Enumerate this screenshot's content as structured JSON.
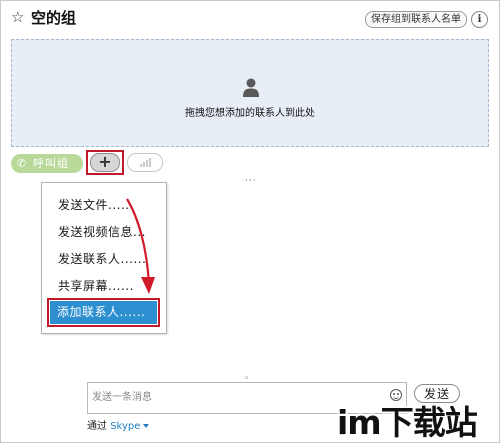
{
  "header": {
    "title": "空的组",
    "save_label": "保存组到联系人名单",
    "info_label": "i"
  },
  "dropzone": {
    "text": "拖拽您想添加的联系人到此处"
  },
  "toolbar": {
    "call_label": "呼叫组",
    "plus_label": "+"
  },
  "menu": {
    "items": [
      {
        "label": "发送文件......"
      },
      {
        "label": "发送视频信息..."
      },
      {
        "label": "发送联系人......"
      },
      {
        "label": "共享屏幕......"
      },
      {
        "label": "添加联系人......",
        "selected": true
      }
    ]
  },
  "compose": {
    "placeholder": "发送一条消息",
    "send_label": "发送",
    "via_prefix": "通过",
    "via_service": "Skype"
  },
  "watermark": {
    "text": "im下载站"
  },
  "colors": {
    "accent": "#2d8fd0",
    "highlight": "#c0192b",
    "call_green": "#b9d99a",
    "dropzone_bg": "#e8eef5"
  },
  "icons": [
    "star-icon",
    "info-icon",
    "person-icon",
    "phone-icon",
    "plus-icon",
    "signal-icon",
    "emoji-icon",
    "caret-down-icon",
    "arrow-annotation"
  ]
}
